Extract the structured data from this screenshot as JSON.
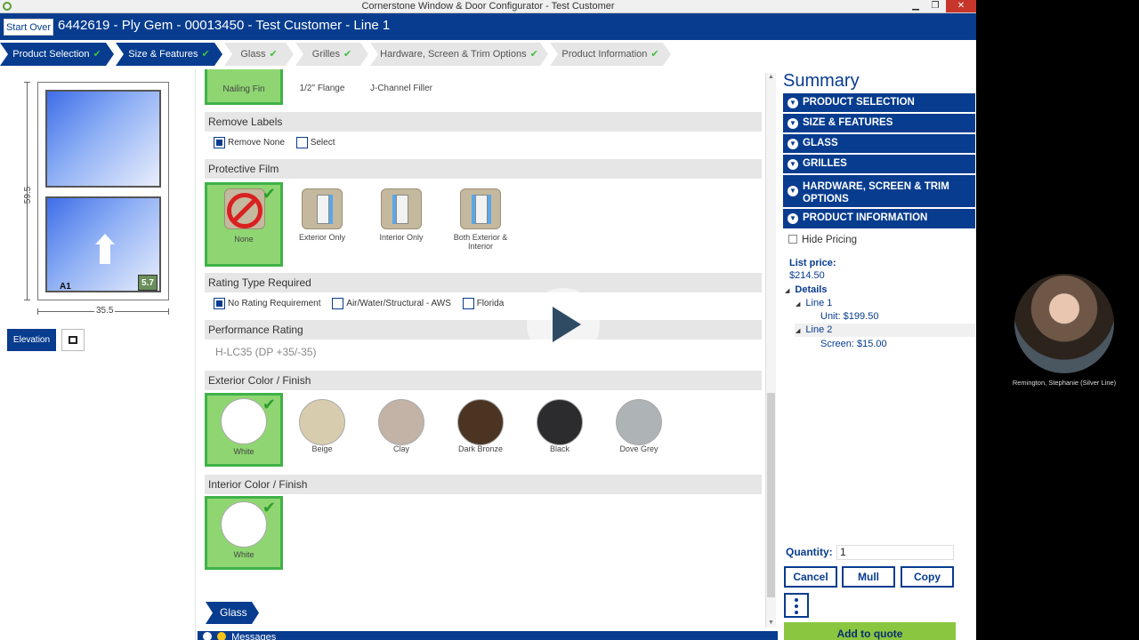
{
  "window": {
    "title": "Cornerstone Window & Door Configurator - Test Customer"
  },
  "header": {
    "start_over": "Start Over",
    "title": "6442619 - Ply Gem - 00013450 - Test Customer - Line 1"
  },
  "steps": [
    {
      "label": "Product Selection",
      "complete": true
    },
    {
      "label": "Size & Features",
      "complete": true
    },
    {
      "label": "Glass",
      "complete": true
    },
    {
      "label": "Grilles",
      "complete": true
    },
    {
      "label": "Hardware, Screen & Trim Options",
      "complete": true
    },
    {
      "label": "Product Information",
      "complete": true
    }
  ],
  "preview": {
    "height": "59.5",
    "width": "35.5",
    "sash_label": "A1",
    "sash_badge": "5.7",
    "elevation": "Elevation"
  },
  "options": {
    "top_tiles": [
      "Nailing Fin",
      "1/2\" Flange",
      "J-Channel Filler"
    ],
    "remove_labels": {
      "title": "Remove Labels",
      "options": [
        "Remove None",
        "Select"
      ],
      "selected": "Remove None"
    },
    "protective_film": {
      "title": "Protective Film",
      "tiles": [
        "None",
        "Exterior Only",
        "Interior Only",
        "Both Exterior & Interior"
      ],
      "selected": "None"
    },
    "rating_type": {
      "title": "Rating Type Required",
      "options": [
        "No Rating Requirement",
        "Air/Water/Structural - AWS",
        "Florida"
      ],
      "selected": "No Rating Requirement"
    },
    "performance_rating": {
      "title": "Performance Rating",
      "value": "H-LC35 (DP +35/-35)"
    },
    "exterior_color": {
      "title": "Exterior Color / Finish",
      "tiles": [
        {
          "label": "White",
          "color": "#ffffff"
        },
        {
          "label": "Beige",
          "color": "#d8ccae"
        },
        {
          "label": "Clay",
          "color": "#c2b3a6"
        },
        {
          "label": "Dark Bronze",
          "color": "#4b3522"
        },
        {
          "label": "Black",
          "color": "#2c2c2e"
        },
        {
          "label": "Dove Grey",
          "color": "#aeb3b5"
        }
      ],
      "selected": "White"
    },
    "interior_color": {
      "title": "Interior Color / Finish",
      "tiles": [
        {
          "label": "White",
          "color": "#ffffff"
        }
      ],
      "selected": "White"
    },
    "glass_tab": "Glass",
    "messages": "Messages"
  },
  "summary": {
    "title": "Summary",
    "sections": [
      "PRODUCT SELECTION",
      "SIZE & FEATURES",
      "GLASS",
      "GRILLES",
      "HARDWARE, SCREEN & TRIM OPTIONS",
      "PRODUCT INFORMATION"
    ],
    "hide_pricing": "Hide Pricing",
    "list_price_label": "List price:",
    "list_price": "$214.50",
    "details": "Details",
    "line1": "Line 1",
    "line1_unit": "Unit: $199.50",
    "line2": "Line 2",
    "line2_screen": "Screen: $15.00",
    "quantity_label": "Quantity:",
    "quantity": "1",
    "cancel": "Cancel",
    "mull": "Mull",
    "copy": "Copy",
    "add_to_quote": "Add to quote"
  },
  "webcam": {
    "name": "Remington, Stephanie  (Silver Line)"
  },
  "colors": {
    "brand": "#073c8f",
    "selected": "#8fd672",
    "accent_green": "#8ac640"
  }
}
